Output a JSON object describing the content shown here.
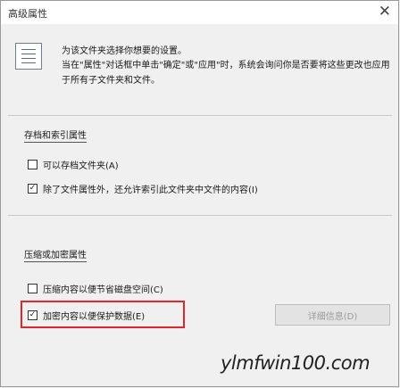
{
  "window": {
    "title": "高级属性",
    "close_glyph": "✕"
  },
  "intro": {
    "line1": "为该文件夹选择你想要的设置。",
    "line2": "当在\"属性\"对话框中单击\"确定\"或\"应用\"时，系统会询问你是否要将这些更改也应用于所有子文件夹和文件。"
  },
  "archive_group": {
    "title": "存档和索引属性",
    "options": [
      {
        "label": "可以存档文件夹(A)",
        "checked": false
      },
      {
        "label": "除了文件属性外，还允许索引此文件夹中文件的内容(I)",
        "checked": true
      }
    ]
  },
  "compress_group": {
    "title": "压缩或加密属性",
    "options": [
      {
        "label": "压缩内容以便节省磁盘空间(C)",
        "checked": false
      },
      {
        "label": "加密内容以便保护数据(E)",
        "checked": true
      }
    ],
    "details_button": "详细信息(D)"
  },
  "watermark": "ylmfwin100.com",
  "colors": {
    "highlight": "#e0282a",
    "background": "#f0f0f0"
  }
}
